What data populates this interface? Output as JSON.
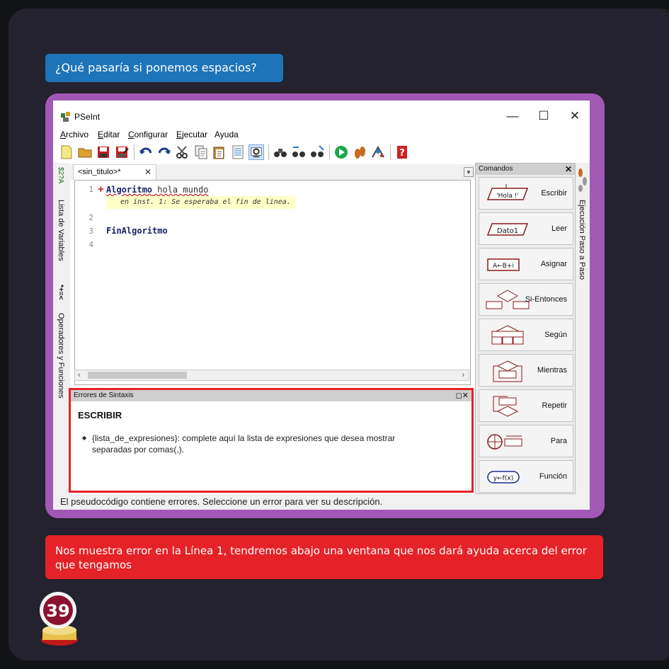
{
  "question": "¿Qué pasaría si ponemos espacios?",
  "window": {
    "title": "PSeInt",
    "controls": {
      "minimize": "—",
      "maximize": "☐",
      "close": "✕"
    }
  },
  "menu": [
    {
      "hot": "A",
      "rest": "rchivo"
    },
    {
      "hot": "E",
      "rest": "ditar"
    },
    {
      "hot": "C",
      "rest": "onfigurar"
    },
    {
      "hot": "E",
      "rest": "jecutar"
    },
    {
      "hot": "",
      "rest": "Ayuda"
    }
  ],
  "toolbar_icons": [
    "new-file-icon",
    "open-folder-icon",
    "save-icon",
    "save-as-icon",
    "undo-icon",
    "redo-icon",
    "cut-icon",
    "copy-icon",
    "paste-icon",
    "list-icon",
    "magnifier-icon",
    "binoculars-icon",
    "find-icon",
    "replace-icon",
    "run-icon",
    "step-icon",
    "debug-icon",
    "help-icon"
  ],
  "left_strip": {
    "variables": "Lista de Variables",
    "operators": "Operadores y Funciones",
    "sym1": "*+=<",
    "sym2": "$2?A"
  },
  "tab": {
    "label": "<sin_titulo>*",
    "close": "✕"
  },
  "editor": {
    "line_numbers": [
      "1",
      "2",
      "3",
      "4"
    ],
    "line1_kw": "Algoritmo",
    "line1_rest": " hola mundo",
    "error_inline": "en inst. 1: Se esperaba el fin de linea.",
    "line3_kw": "FinAlgoritmo"
  },
  "errors_panel": {
    "header": "Errores de Sintaxis",
    "title": "ESCRIBIR",
    "bullet": "{lista_de_expresiones}: complete aquí la lista de expresiones que desea mostrar separadas por comas(,)."
  },
  "status": "El pseudocódigo contiene errores. Seleccione un error para ver su descripción.",
  "commands": {
    "header": "Comandos",
    "items": [
      {
        "label": "Escribir",
        "icon": "escribir-icon",
        "glyph": "'Hola !'"
      },
      {
        "label": "Leer",
        "icon": "leer-icon",
        "glyph": "Dato1"
      },
      {
        "label": "Asignar",
        "icon": "asignar-icon",
        "glyph": "A←B+i"
      },
      {
        "label": "Si-Entonces",
        "icon": "si-entonces-icon",
        "glyph": ""
      },
      {
        "label": "Según",
        "icon": "segun-icon",
        "glyph": ""
      },
      {
        "label": "Mientras",
        "icon": "mientras-icon",
        "glyph": ""
      },
      {
        "label": "Repetir",
        "icon": "repetir-icon",
        "glyph": ""
      },
      {
        "label": "Para",
        "icon": "para-icon",
        "glyph": ""
      },
      {
        "label": "Función",
        "icon": "funcion-icon",
        "glyph": "y←f(x)"
      }
    ]
  },
  "right_strip": {
    "label": "Ejecución Paso a Paso"
  },
  "answer": "Nos muestra error en la Línea 1, tendremos abajo una ventana que nos dará ayuda acerca del error que tengamos",
  "page_badge": "39"
}
